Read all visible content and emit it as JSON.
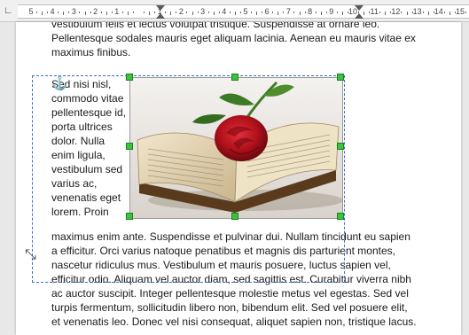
{
  "ruler": {
    "tab_icon": "tab-stop-icon",
    "numbers": [
      "5",
      "4",
      "3",
      "2",
      "1",
      "1",
      "2",
      "3",
      "4",
      "5",
      "6",
      "7",
      "8",
      "9",
      "10",
      "11",
      "12",
      "13",
      "14",
      "15"
    ]
  },
  "document": {
    "top_lines": [
      "vestibulum felis et lectus volutpat tristique. Suspendisse at ornare leo.",
      "Pellentesque sodales mauris eget aliquam lacinia. Aenean eu mauris vitae ex",
      "maximus finibus."
    ],
    "wrap_lines": [
      "Sed nisi nisl,",
      "commodo vitae",
      "pellentesque id,",
      "porta ultrices",
      "dolor. Nulla",
      "enim ligula,",
      "vestibulum sed",
      "varius ac,",
      "venenatis eget",
      "lorem. Proin"
    ],
    "bottom_lines": [
      "maximus enim ante. Suspendisse et pulvinar dui. Nullam tincidunt eu sapien",
      "a efficitur. Orci varius natoque penatibus et magnis dis parturient montes,",
      "nascetur ridiculus mus. Vestibulum et mauris posuere, luctus sapien vel,",
      "efficitur odio. Aliquam vel auctor diam, sed sagittis est. Curabitur viverra nibh",
      "ac auctor suscipit. Integer pellentesque molestie metus vel egestas. Sed vel",
      "turpis fermentum, sollicitudin libero non, bibendum elit. Sed vel posuere elit,",
      "et venenatis leo. Donec vel nisi consequat, aliquet sapien non, tristique lacus."
    ]
  },
  "image": {
    "subject": "rose-on-open-book",
    "colors": {
      "rose": "#c0121b",
      "leaf": "#3e7a23",
      "page": "#e9dcc0",
      "bg": "#ece9e6"
    }
  },
  "selection": {
    "frame_color": "#3a6fc4",
    "handle_color": "#38c43c",
    "anchor_icon": "anchor-icon",
    "resize_icon": "resize-diagonal-icon"
  }
}
